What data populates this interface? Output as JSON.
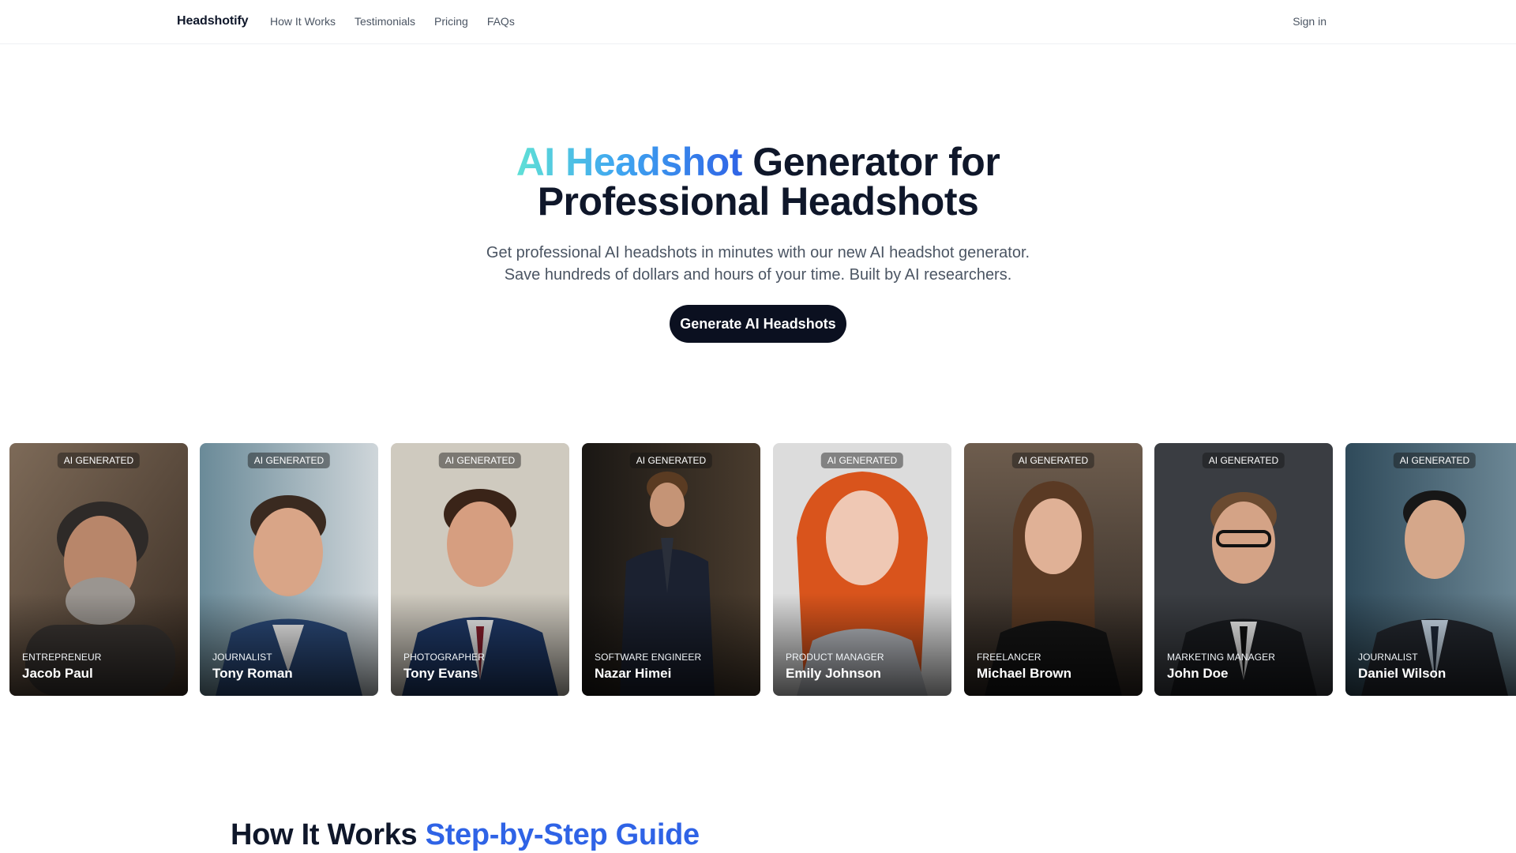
{
  "nav": {
    "brand": "Headshotify",
    "links": [
      "How It Works",
      "Testimonials",
      "Pricing",
      "FAQs"
    ],
    "sign_in": "Sign in"
  },
  "hero": {
    "title_accent": "AI Headshot",
    "title_rest_line1": "Generator for",
    "title_line2": "Professional Headshots",
    "subtitle_line1": "Get professional AI headshots in minutes with our new AI headshot generator.",
    "subtitle_line2": "Save hundreds of dollars and hours of your time. Built by AI researchers.",
    "cta_label": "Generate AI Headshots"
  },
  "gallery": {
    "cards": [
      {
        "badge": "AI GENERATED",
        "role": "ENTREPRENEUR",
        "name": "Jacob Paul"
      },
      {
        "badge": "AI GENERATED",
        "role": "JOURNALIST",
        "name": "Tony Roman"
      },
      {
        "badge": "AI GENERATED",
        "role": "PHOTOGRAPHER",
        "name": "Tony Evans"
      },
      {
        "badge": "AI GENERATED",
        "role": "SOFTWARE ENGINEER",
        "name": "Nazar Himei"
      },
      {
        "badge": "AI GENERATED",
        "role": "PRODUCT MANAGER",
        "name": "Emily Johnson"
      },
      {
        "badge": "AI GENERATED",
        "role": "FREELANCER",
        "name": "Michael Brown"
      },
      {
        "badge": "AI GENERATED",
        "role": "MARKETING MANAGER",
        "name": "John Doe"
      },
      {
        "badge": "AI GENERATED",
        "role": "JOURNALIST",
        "name": "Daniel Wilson"
      }
    ]
  },
  "how_it_works": {
    "title": "How It Works",
    "accent": "Step-by-Step Guide"
  },
  "colors": {
    "primary_dark": "#0b1020",
    "accent_blue": "#2f63e6",
    "gradient_start": "#5fe0d6"
  }
}
